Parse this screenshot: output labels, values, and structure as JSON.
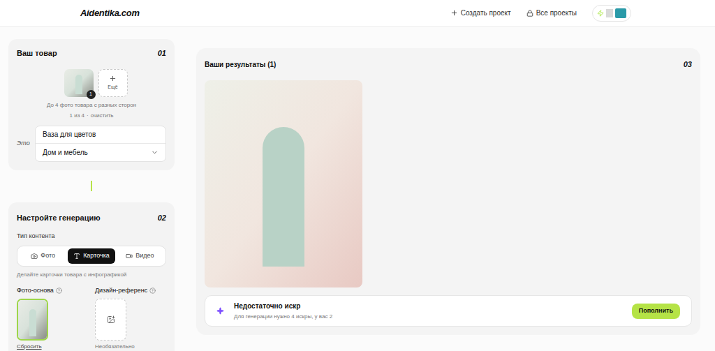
{
  "header": {
    "logo": "Aidentika.com",
    "links": [
      "Создать проект",
      "Все проекты"
    ]
  },
  "product": {
    "title": "Ваш товар",
    "step": "01",
    "photo_badge": "1",
    "add_label": "Ещё",
    "hint": "До 4 фото товара с разных сторон",
    "counter": "1 из 4",
    "separator": "·",
    "clear": "очистить",
    "this_label": "Это",
    "name_value": "Ваза для цветов",
    "category": "Дом и мебель"
  },
  "settings": {
    "title": "Настройте генерацию",
    "step": "02",
    "content_type_label": "Тип контента",
    "content_types": [
      {
        "label": "Фото",
        "kind": "photo",
        "selected": false
      },
      {
        "label": "Карточка",
        "kind": "card",
        "selected": true
      },
      {
        "label": "Видео",
        "kind": "video",
        "selected": false
      }
    ],
    "content_hint": "Делайте карточки товара с инфографикой",
    "base_photo": {
      "label": "Фото-основа",
      "action": "Сбросить"
    },
    "design_reference": {
      "label": "Дизайн-референс",
      "hint": "Необязательно"
    }
  },
  "results": {
    "title": "Ваши результаты (1)",
    "step": "03",
    "notice": {
      "title": "Недостаточно искр",
      "text": "Для генерации нужно 4 искры, у вас 2",
      "button": "Пополнить"
    }
  }
}
